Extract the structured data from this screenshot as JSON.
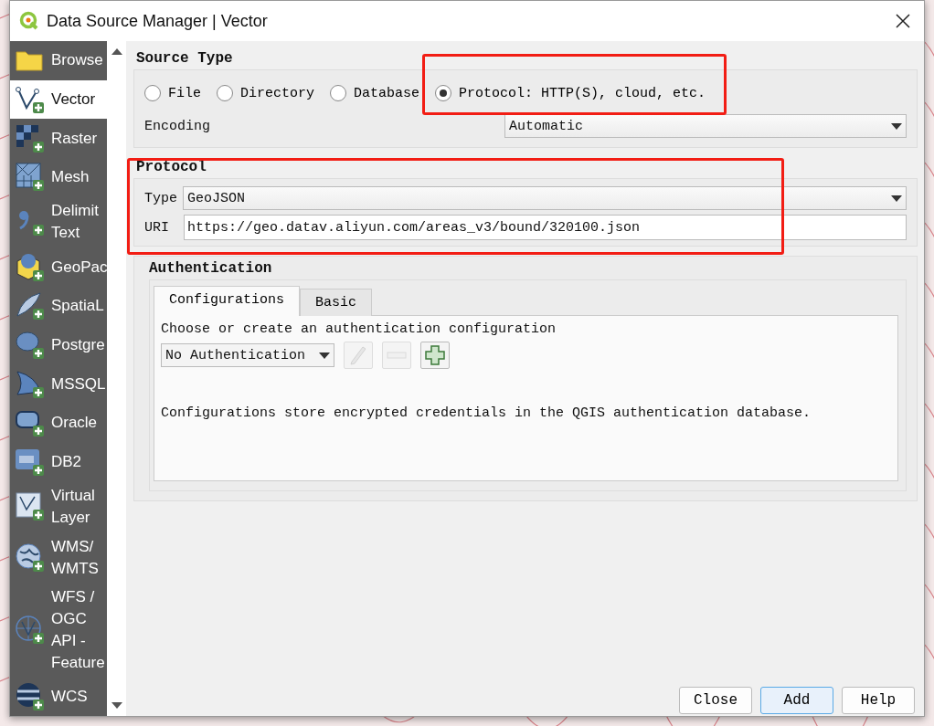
{
  "window": {
    "title": "Data Source Manager | Vector"
  },
  "sidebar": {
    "items": [
      {
        "label": "Browse",
        "selected": false
      },
      {
        "label": "Vector",
        "selected": true
      },
      {
        "label": "Raster",
        "selected": false
      },
      {
        "label": "Mesh",
        "selected": false
      },
      {
        "label": "Delimit\nText",
        "selected": false
      },
      {
        "label": "GeoPac",
        "selected": false
      },
      {
        "label": "SpatiaL",
        "selected": false
      },
      {
        "label": "Postgre",
        "selected": false
      },
      {
        "label": "MSSQL",
        "selected": false
      },
      {
        "label": "Oracle",
        "selected": false
      },
      {
        "label": "DB2",
        "selected": false
      },
      {
        "label": "Virtual\nLayer",
        "selected": false
      },
      {
        "label": "WMS/\nWMTS",
        "selected": false
      },
      {
        "label": "WFS /\nOGC\nAPI -\nFeature",
        "selected": false
      },
      {
        "label": "WCS",
        "selected": false
      }
    ]
  },
  "source_type": {
    "title": "Source Type",
    "options": [
      {
        "label": "File",
        "selected": false
      },
      {
        "label": "Directory",
        "selected": false
      },
      {
        "label": "Database",
        "selected": false
      },
      {
        "label": "Protocol: HTTP(S), cloud, etc.",
        "selected": true
      }
    ],
    "encoding": {
      "label": "Encoding",
      "value": "Automatic"
    }
  },
  "protocol": {
    "title": "Protocol",
    "type": {
      "label": "Type",
      "value": "GeoJSON"
    },
    "uri": {
      "label": "URI",
      "value": "https://geo.datav.aliyun.com/areas_v3/bound/320100.json"
    }
  },
  "authentication": {
    "title": "Authentication",
    "tabs": [
      {
        "label": "Configurations",
        "selected": true
      },
      {
        "label": "Basic",
        "selected": false
      }
    ],
    "prompt": "Choose or create an authentication configuration",
    "config": "No Authentication",
    "tool_buttons": [
      {
        "disabled": true
      },
      {
        "disabled": true
      },
      {
        "disabled": false
      }
    ],
    "note": "Configurations store encrypted credentials in the QGIS authentication database."
  },
  "buttons": [
    {
      "label": "Close",
      "default": false
    },
    {
      "label": "Add",
      "default": true
    },
    {
      "label": "Help",
      "default": false
    }
  ]
}
